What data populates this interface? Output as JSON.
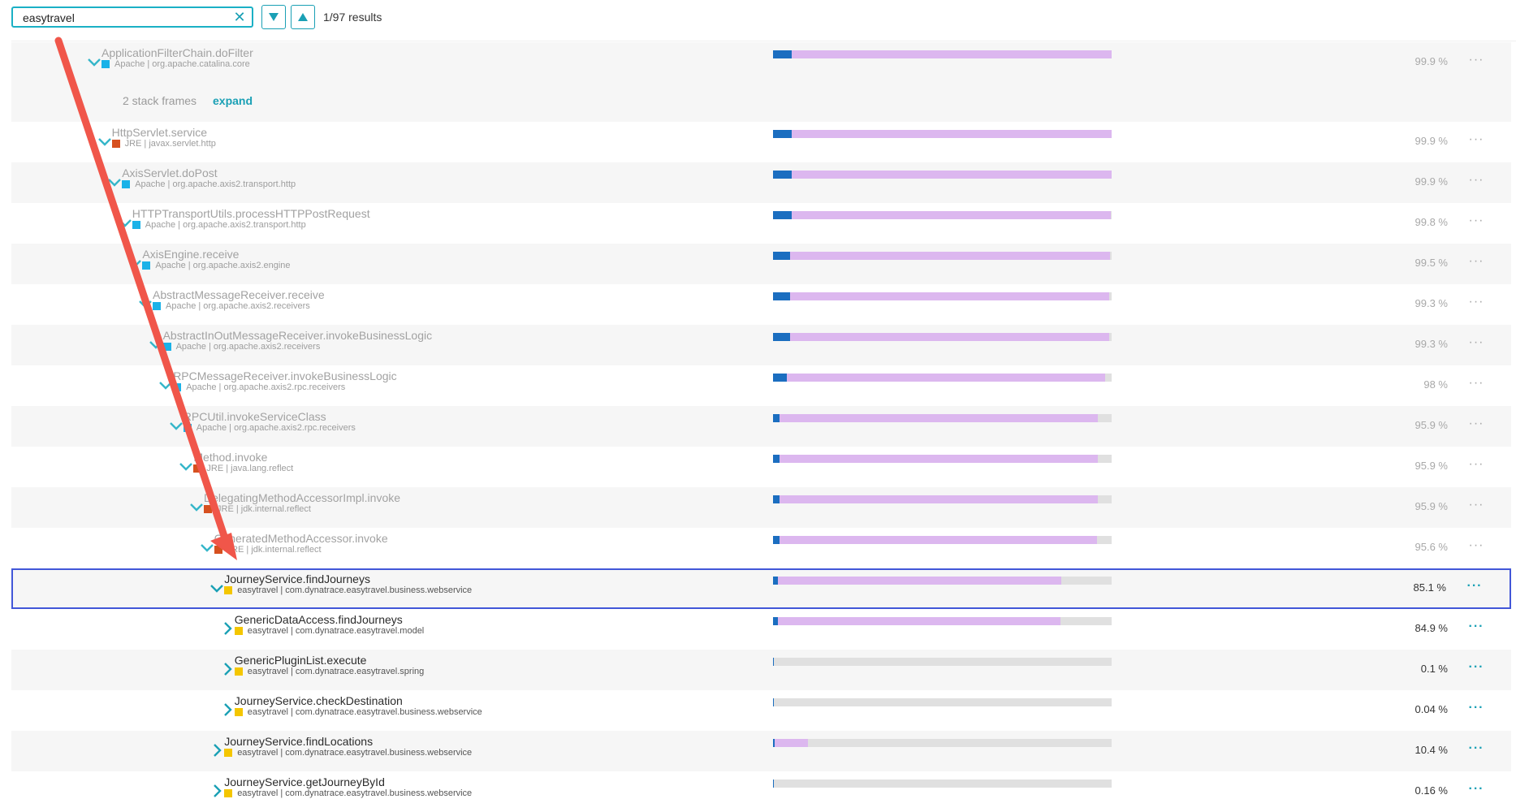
{
  "search": {
    "value": "easytravel",
    "results": "1/97 results"
  },
  "colors": {
    "accent": "#1aa0b5",
    "selected_border": "#4257d8",
    "bar_total": "#dcb7ef",
    "bar_self": "#1b6ec0",
    "apache": "#1ab2e8",
    "jre": "#d6501f",
    "easytravel": "#f4c600"
  },
  "collapsed": {
    "text": "2 stack frames",
    "link": "expand"
  },
  "rows": [
    {
      "method": "ApplicationFilterChain.doFilter",
      "meta": "Apache | org.apache.catalina.core",
      "pct": "99.9 %",
      "total": 1.0,
      "self": 0.055,
      "kind": "apache",
      "indent": 0,
      "state": "open",
      "faded": true
    },
    {
      "method": "HttpServlet.service",
      "meta": "JRE | javax.servlet.http",
      "pct": "99.9 %",
      "total": 1.0,
      "self": 0.055,
      "kind": "jre",
      "indent": 1,
      "state": "open",
      "faded": true
    },
    {
      "method": "AxisServlet.doPost",
      "meta": "Apache | org.apache.axis2.transport.http",
      "pct": "99.9 %",
      "total": 1.0,
      "self": 0.055,
      "kind": "apache",
      "indent": 2,
      "state": "open",
      "faded": true
    },
    {
      "method": "HTTPTransportUtils.processHTTPPostRequest",
      "meta": "Apache | org.apache.axis2.transport.http",
      "pct": "99.8 %",
      "total": 0.998,
      "self": 0.055,
      "kind": "apache",
      "indent": 3,
      "state": "open",
      "faded": true
    },
    {
      "method": "AxisEngine.receive",
      "meta": "Apache | org.apache.axis2.engine",
      "pct": "99.5 %",
      "total": 0.995,
      "self": 0.05,
      "kind": "apache",
      "indent": 4,
      "state": "open",
      "faded": true
    },
    {
      "method": "AbstractMessageReceiver.receive",
      "meta": "Apache | org.apache.axis2.receivers",
      "pct": "99.3 %",
      "total": 0.993,
      "self": 0.05,
      "kind": "apache",
      "indent": 5,
      "state": "open",
      "faded": true
    },
    {
      "method": "AbstractInOutMessageReceiver.invokeBusinessLogic",
      "meta": "Apache | org.apache.axis2.receivers",
      "pct": "99.3 %",
      "total": 0.993,
      "self": 0.05,
      "kind": "apache",
      "indent": 6,
      "state": "open",
      "faded": true
    },
    {
      "method": "RPCMessageReceiver.invokeBusinessLogic",
      "meta": "Apache | org.apache.axis2.rpc.receivers",
      "pct": "98 %",
      "total": 0.98,
      "self": 0.04,
      "kind": "apache",
      "indent": 7,
      "state": "open",
      "faded": true
    },
    {
      "method": "RPCUtil.invokeServiceClass",
      "meta": "Apache | org.apache.axis2.rpc.receivers",
      "pct": "95.9 %",
      "total": 0.959,
      "self": 0.018,
      "kind": "apache",
      "indent": 8,
      "state": "open",
      "faded": true
    },
    {
      "method": "Method.invoke",
      "meta": "JRE | java.lang.reflect",
      "pct": "95.9 %",
      "total": 0.959,
      "self": 0.018,
      "kind": "jre",
      "indent": 9,
      "state": "open",
      "faded": true
    },
    {
      "method": "DelegatingMethodAccessorImpl.invoke",
      "meta": "JRE | jdk.internal.reflect",
      "pct": "95.9 %",
      "total": 0.959,
      "self": 0.018,
      "kind": "jre",
      "indent": 10,
      "state": "open",
      "faded": true
    },
    {
      "method": "GeneratedMethodAccessor.invoke",
      "meta": "JRE | jdk.internal.reflect",
      "pct": "95.6 %",
      "total": 0.956,
      "self": 0.018,
      "kind": "jre",
      "indent": 11,
      "state": "open",
      "faded": true
    },
    {
      "method": "JourneyService.findJourneys",
      "meta": "easytravel | com.dynatrace.easytravel.business.webservice",
      "pct": "85.1 %",
      "total": 0.851,
      "self": 0.014,
      "kind": "easytravel",
      "indent": 12,
      "state": "open",
      "faded": false,
      "selected": true
    },
    {
      "method": "GenericDataAccess.findJourneys",
      "meta": "easytravel | com.dynatrace.easytravel.model",
      "pct": "84.9 %",
      "total": 0.849,
      "self": 0.014,
      "kind": "easytravel",
      "indent": 13,
      "state": "closed",
      "faded": false
    },
    {
      "method": "GenericPluginList.execute",
      "meta": "easytravel | com.dynatrace.easytravel.spring",
      "pct": "0.1 %",
      "total": 0.001,
      "self": 0.001,
      "kind": "easytravel",
      "indent": 13,
      "state": "closed",
      "faded": false
    },
    {
      "method": "JourneyService.checkDestination",
      "meta": "easytravel | com.dynatrace.easytravel.business.webservice",
      "pct": "0.04 %",
      "total": 0.0004,
      "self": 0.0004,
      "kind": "easytravel",
      "indent": 13,
      "state": "closed",
      "faded": false
    },
    {
      "method": "JourneyService.findLocations",
      "meta": "easytravel | com.dynatrace.easytravel.business.webservice",
      "pct": "10.4 %",
      "total": 0.104,
      "self": 0.004,
      "kind": "easytravel",
      "indent": 12,
      "state": "closed",
      "faded": false
    },
    {
      "method": "JourneyService.getJourneyById",
      "meta": "easytravel | com.dynatrace.easytravel.business.webservice",
      "pct": "0.16 %",
      "total": 0.0016,
      "self": 0.0016,
      "kind": "easytravel",
      "indent": 12,
      "state": "closed",
      "faded": false
    }
  ]
}
